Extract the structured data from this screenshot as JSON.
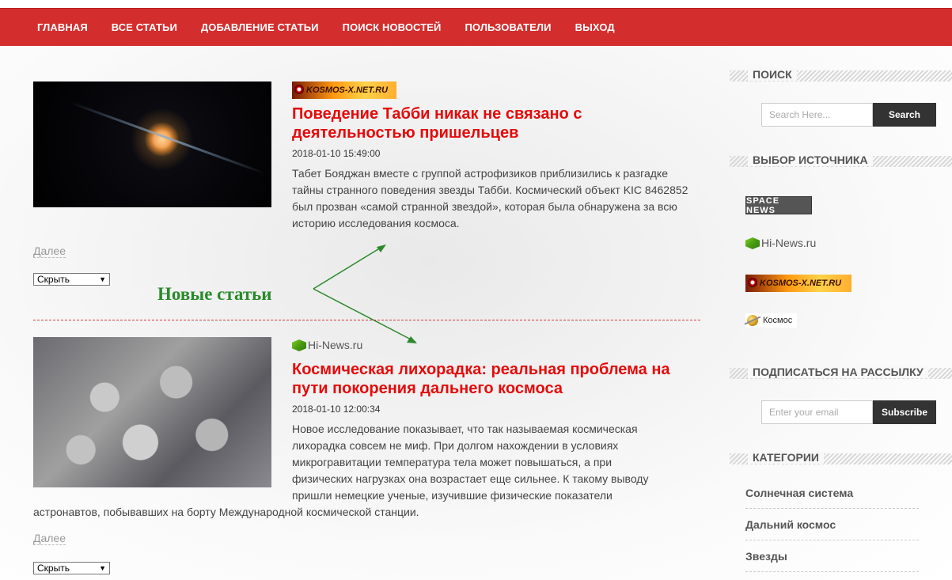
{
  "nav": {
    "items": [
      "ГЛАВНАЯ",
      "ВСЕ СТАТЬИ",
      "ДОБАВЛЕНИЕ СТАТЬИ",
      "ПОИСК НОВОСТЕЙ",
      "ПОЛЬЗОВАТЕЛИ",
      "ВЫХОД"
    ]
  },
  "articles": [
    {
      "source_logo_text": "KOSMOS-X.NET.RU",
      "title": "Поведение Табби никак не связано с деятельностью пришельцев",
      "date": "2018-01-10 15:49:00",
      "text": "Табет Бояджан вместе с группой астрофизиков приблизились к разгадке тайны странного поведения звезды Табби. Космический объект KIC 8462852 был прозван «самой странной звездой», которая была обнаружена за всю историю исследования космоса.",
      "more_label": "Далее",
      "select_value": "Скрыть"
    },
    {
      "source_logo_text": "Hi-News.ru",
      "title": "Космическая лихорадка: реальная проблема на пути покорения дальнего космоса",
      "date": "2018-01-10 12:00:34",
      "text_lines": [
        "Новое исследование показывает, что так называемая космическая",
        "лихорадка совсем не миф. При долгом нахождении в условиях",
        "микрогравитации температура тела может повышаться, а при",
        "физических нагрузках она возрастает еще сильнее. К такому выводу",
        "пришли немецкие ученые, изучившие физические показатели"
      ],
      "text_tail": "астронавтов, побывавших на борту Международной космической станции.",
      "more_label": "Далее",
      "select_value": "Скрыть"
    }
  ],
  "annotation": "Новые статьи",
  "sidebar": {
    "search": {
      "heading": "ПОИСК",
      "placeholder": "Search Here...",
      "button": "Search"
    },
    "sources": {
      "heading": "ВЫБОР ИСТОЧНИКА",
      "items": [
        "SPACE NEWS",
        "Hi-News.ru",
        "KOSMOS-X.NET.RU",
        "Космос"
      ]
    },
    "subscribe": {
      "heading": "ПОДПИСАТЬСЯ НА РАССЫЛКУ",
      "placeholder": "Enter your email",
      "button": "Subscribe"
    },
    "categories": {
      "heading": "КАТЕГОРИИ",
      "items": [
        "Солнечная система",
        "Дальний космос",
        "Звезды"
      ]
    }
  },
  "colors": {
    "nav_bg": "#d42d2d",
    "title": "#e60a0a",
    "annotation": "#2a8a2a",
    "button_dark": "#333333"
  }
}
